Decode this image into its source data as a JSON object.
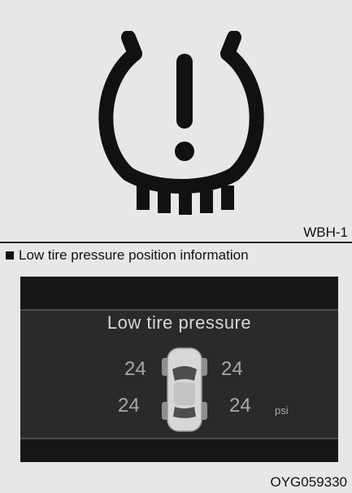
{
  "warning_figure": {
    "icon": "tpms-warning-icon",
    "code": "WBH-1"
  },
  "caption": {
    "bullet": "square-bullet",
    "text": "Low tire pressure position information"
  },
  "cluster_display": {
    "title": "Low tire pressure",
    "pressures": {
      "front_left": "24",
      "front_right": "24",
      "rear_left": "24",
      "rear_right": "24"
    },
    "unit": "psi",
    "car_icon": "car-top-view-icon"
  },
  "figure_code": "OYG059330"
}
